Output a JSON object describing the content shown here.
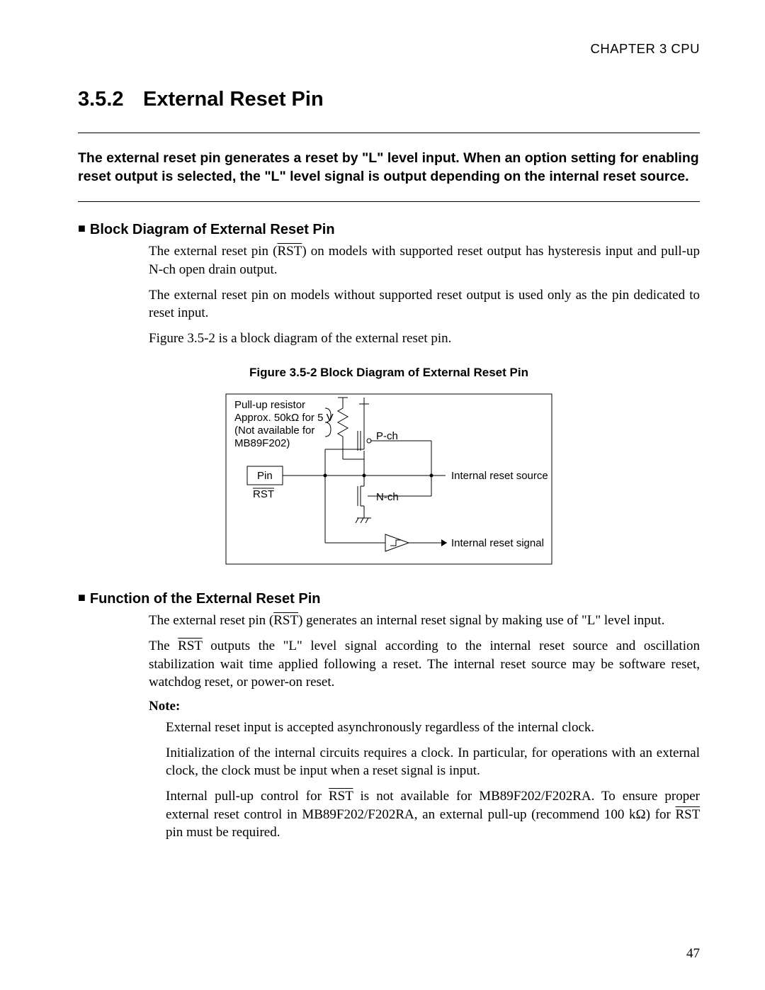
{
  "header": {
    "chapter": "CHAPTER 3  CPU"
  },
  "section": {
    "number": "3.5.2",
    "title": "External Reset Pin"
  },
  "abstract": "The external reset pin generates a reset by \"L\" level input. When an option setting for enabling reset output is selected, the \"L\" level signal is output depending on the internal reset source.",
  "sub1": {
    "heading": "Block Diagram of External Reset Pin",
    "p1_a": "The external reset pin (",
    "p1_rst": "RST",
    "p1_b": ") on models with supported reset output has hysteresis input and pull-up N-ch open drain output.",
    "p2": "The external reset pin on models without supported reset output is used only as the pin dedicated to reset input.",
    "p3": "Figure 3.5-2 is a block diagram of the external reset pin."
  },
  "figure": {
    "caption": "Figure 3.5-2  Block Diagram of External Reset Pin",
    "labels": {
      "pullup1": "Pull-up resistor",
      "pullup2": "Approx. 50kΩ for 5 V",
      "pullup3": "(Not available for",
      "pullup4": "MB89F202)",
      "pch": "P-ch",
      "nch": "N-ch",
      "pin": "Pin",
      "rst": "RST",
      "src": "Internal reset source",
      "sig": "Internal reset signal"
    }
  },
  "sub2": {
    "heading": "Function of the External Reset Pin",
    "p1_a": "The external reset pin (",
    "p1_rst": "RST",
    "p1_b": ") generates an internal reset signal by making use of \"L\" level input.",
    "p2_a": "The ",
    "p2_rst": "RST",
    "p2_b": " outputs the \"L\" level signal according to the internal reset source and oscillation stabilization wait time applied following a reset. The internal reset source may be software reset, watchdog reset, or power-on reset.",
    "note_head": "Note:",
    "n1": "External reset input is accepted asynchronously regardless of the internal clock.",
    "n2": "Initialization of the internal circuits requires a clock. In particular, for operations with an external clock, the clock must be input when a reset signal is input.",
    "n3_a": "Internal pull-up control for ",
    "n3_rst1": "RST",
    "n3_b": " is not available for MB89F202/F202RA. To ensure proper external reset control in MB89F202/F202RA, an external pull-up (recommend 100 kΩ) for ",
    "n3_rst2": "RST",
    "n3_c": " pin must be required."
  },
  "page_number": "47"
}
